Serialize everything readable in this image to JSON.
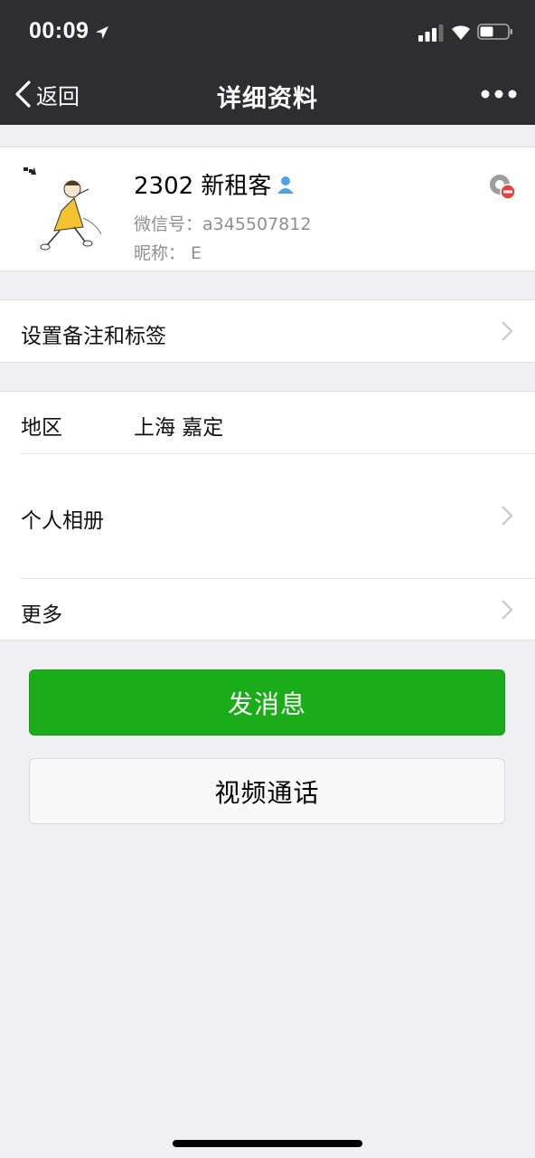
{
  "status_bar": {
    "time": "00:09"
  },
  "nav": {
    "back_label": "返回",
    "title": "详细资料"
  },
  "profile": {
    "name": "2302 新租客",
    "wechat_id": "微信号：a345507812",
    "nickname": "昵称：  E"
  },
  "rows": {
    "remark_tags": "设置备注和标签",
    "region_label": "地区",
    "region_value": "上海 嘉定",
    "album": "个人相册",
    "more": "更多"
  },
  "buttons": {
    "send_message": "发消息",
    "video_call": "视频通话"
  },
  "colors": {
    "nav_bg": "#2e2e31",
    "primary_green": "#1aad19",
    "page_bg": "#efeff4",
    "contact_icon_blue": "#4aa3e8",
    "status_red": "#e6403c"
  },
  "icons": [
    "location-arrow-icon",
    "cellular-signal-icon",
    "wifi-icon",
    "battery-icon",
    "back-chevron-icon",
    "more-dots-icon",
    "contact-person-icon",
    "blocked-status-icon",
    "chevron-right-icon"
  ]
}
